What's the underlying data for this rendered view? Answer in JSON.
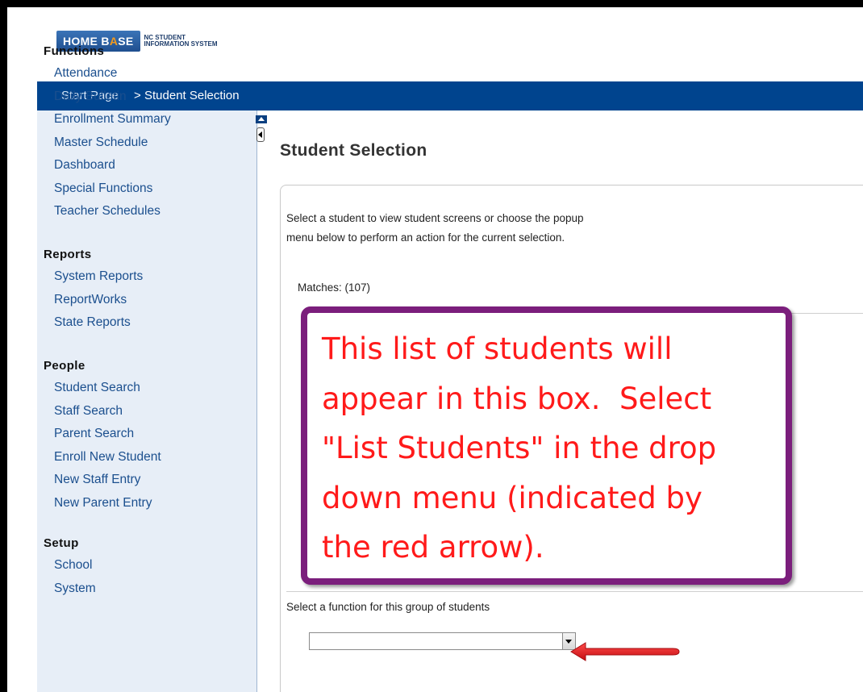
{
  "logo": {
    "main_part1": "HOME B",
    "main_accent": "A",
    "main_part2": "SE",
    "sub_line1": "NC STUDENT",
    "sub_line2": "INFORMATION SYSTEM"
  },
  "breadcrumb": {
    "start": "Start Page",
    "separator": " > ",
    "current": "Student Selection"
  },
  "sidebar": {
    "sections": [
      {
        "title": "Functions",
        "items": [
          "Attendance",
          "Daily Bulletin",
          "Enrollment Summary",
          "Master Schedule",
          "Dashboard",
          "Special Functions",
          "Teacher Schedules"
        ]
      },
      {
        "title": "Reports",
        "items": [
          "System Reports",
          "ReportWorks",
          "State Reports"
        ]
      },
      {
        "title": "People",
        "items": [
          "Student Search",
          "Staff Search",
          "Parent Search",
          "Enroll New Student",
          "New Staff Entry",
          "New Parent Entry"
        ]
      },
      {
        "title": "Setup",
        "items": [
          "School",
          "System"
        ]
      }
    ]
  },
  "main": {
    "title": "Student Selection",
    "intro_line1": "Select a student to view student screens or choose the popup",
    "intro_line2": "menu below to perform an action for the current selection.",
    "matches_label": "Matches: (107)",
    "function_label": "Select a function for this group of students",
    "function_select_value": ""
  },
  "callout": {
    "lines": [
      "This list of students will",
      "appear in this box.  Select",
      "\"List Students\" in the drop",
      "down menu (indicated by",
      "the red arrow)."
    ],
    "text_color": "#ff1a1a",
    "border_color": "#7b1e7c"
  },
  "colors": {
    "header_blue": "#00448e",
    "sidebar_bg": "#e7eef7",
    "link": "#1b4f8e",
    "arrow_red": "#e3151a"
  }
}
